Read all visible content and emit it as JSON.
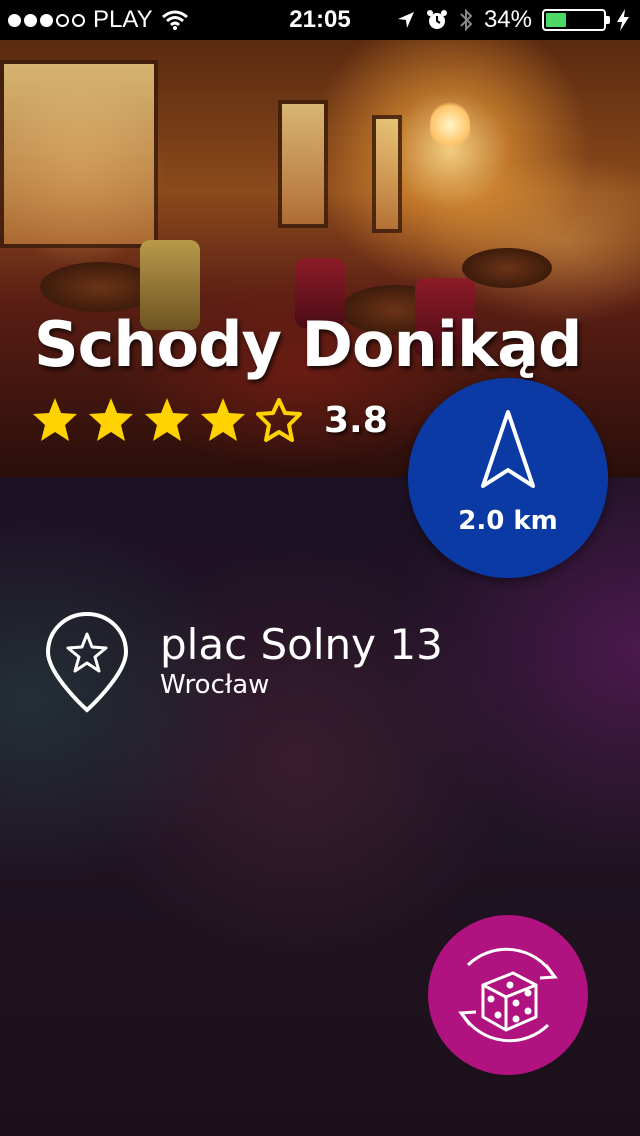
{
  "status_bar": {
    "carrier": "PLAY",
    "time": "21:05",
    "battery_percent": "34%",
    "battery_level": 0.34,
    "signal_bars_filled": 3,
    "signal_bars_total": 5,
    "battery_color": "#4cd964"
  },
  "place": {
    "name": "Schody Donikąd",
    "rating": "3.8",
    "rating_stars": 3.8,
    "rating_max": 5,
    "star_color": "#ffd200"
  },
  "distance": {
    "label": "2.0 km",
    "color": "#0b3aa5",
    "icon": "navigation-arrow-icon"
  },
  "address": {
    "street": "plac Solny 13",
    "city": "Wrocław",
    "icon": "map-pin-star-icon"
  },
  "random_button": {
    "icon": "dice-refresh-icon",
    "color": "#b0127f"
  }
}
